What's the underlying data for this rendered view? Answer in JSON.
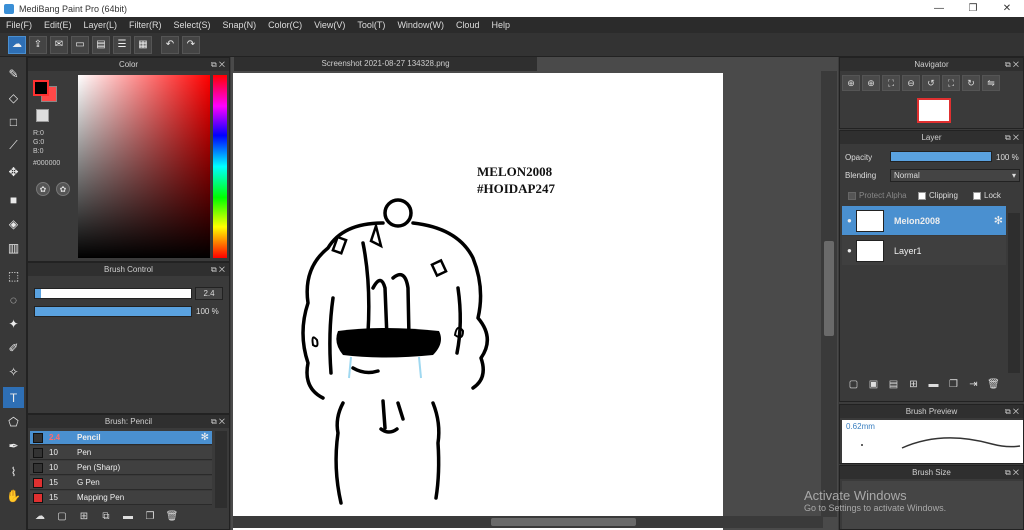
{
  "window": {
    "title": "MediBang Paint Pro (64bit)",
    "minimize": "—",
    "maximize": "❐",
    "close": "✕"
  },
  "menu": [
    "File(F)",
    "Edit(E)",
    "Layer(L)",
    "Filter(R)",
    "Select(S)",
    "Snap(N)",
    "Color(C)",
    "View(V)",
    "Tool(T)",
    "Window(W)",
    "Cloud",
    "Help"
  ],
  "color_panel": {
    "title": "Color",
    "r": "R:0",
    "g": "G:0",
    "b": "B:0",
    "hex": "#000000",
    "fg_color": "#000000",
    "bg_color": "#ff4848"
  },
  "brush_control": {
    "title": "Brush Control",
    "size_value": "2.4",
    "opacity_value": "100 %",
    "size_fraction": 0.95,
    "opacity_fraction": 1.0
  },
  "brush_list": {
    "title": "Brush: Pencil",
    "items": [
      {
        "size": "2.4",
        "name": "Pencil",
        "color": "#333333",
        "selected": true
      },
      {
        "size": "10",
        "name": "Pen",
        "color": "#333333",
        "selected": false
      },
      {
        "size": "10",
        "name": "Pen (Sharp)",
        "color": "#333333",
        "selected": false
      },
      {
        "size": "15",
        "name": "G Pen",
        "color": "#e03030",
        "selected": false
      },
      {
        "size": "15",
        "name": "Mapping Pen",
        "color": "#e03030",
        "selected": false
      }
    ]
  },
  "canvas": {
    "tab_title": "Screenshot 2021-08-27 134328.png",
    "text_line1": "MELON2008",
    "text_line2": "#HOIDAP247"
  },
  "navigator": {
    "title": "Navigator"
  },
  "layer_panel": {
    "title": "Layer",
    "opacity_label": "Opacity",
    "opacity_value": "100 %",
    "blending_label": "Blending",
    "blending_value": "Normal",
    "protect_alpha": "Protect Alpha",
    "clipping": "Clipping",
    "lock": "Lock",
    "layers": [
      {
        "name": "Melon2008",
        "selected": true
      },
      {
        "name": "Layer1",
        "selected": false
      }
    ]
  },
  "brush_preview": {
    "title": "Brush Preview",
    "size": "0.62mm"
  },
  "brush_size": {
    "title": "Brush Size"
  },
  "watermark": {
    "line1": "Activate Windows",
    "line2": "Go to Settings to activate Windows."
  }
}
